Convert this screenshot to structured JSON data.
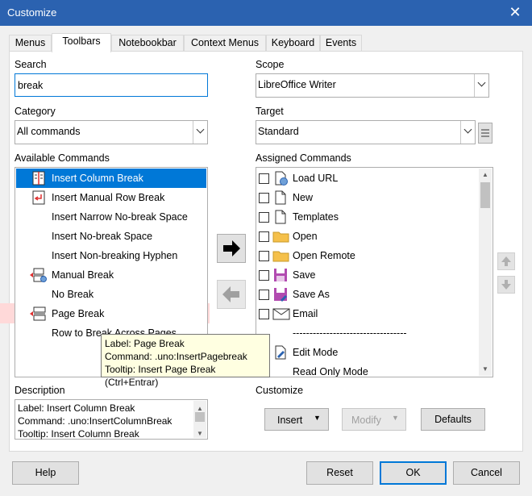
{
  "window": {
    "title": "Customize",
    "close_glyph": "✕"
  },
  "tabs": [
    "Menus",
    "Toolbars",
    "Notebookbar",
    "Context Menus",
    "Keyboard",
    "Events"
  ],
  "search": {
    "label": "Search",
    "value": "break"
  },
  "category": {
    "label": "Category",
    "value": "All commands"
  },
  "available": {
    "label": "Available Commands",
    "items": [
      {
        "label": "Insert Column Break",
        "icon": "column-break-icon",
        "selected": true
      },
      {
        "label": "Insert Manual Row Break",
        "icon": "row-break-icon"
      },
      {
        "label": "Insert Narrow No-break Space",
        "icon": ""
      },
      {
        "label": "Insert No-break Space",
        "icon": ""
      },
      {
        "label": "Insert Non-breaking Hyphen",
        "icon": ""
      },
      {
        "label": "Manual Break",
        "icon": "manual-break-icon"
      },
      {
        "label": "No Break",
        "icon": ""
      },
      {
        "label": "Page Break",
        "icon": "page-break-icon"
      },
      {
        "label": "Row to Break Across Pages",
        "icon": ""
      }
    ]
  },
  "tooltip": {
    "line1": "Label: Page Break",
    "line2": "Command: .uno:InsertPagebreak",
    "line3": "Tooltip: Insert Page Break (Ctrl+Entrar)"
  },
  "description": {
    "label": "Description",
    "line1": "Label: Insert Column Break",
    "line2": "Command: .uno:InsertColumnBreak",
    "line3": "Tooltip: Insert Column Break"
  },
  "scope": {
    "label": "Scope",
    "value": "LibreOffice Writer"
  },
  "target": {
    "label": "Target",
    "value": "Standard"
  },
  "assigned": {
    "label": "Assigned Commands",
    "items": [
      {
        "label": "Load URL",
        "icon": "load-url-icon"
      },
      {
        "label": "New",
        "icon": "document-icon"
      },
      {
        "label": "Templates",
        "icon": "document-icon"
      },
      {
        "label": "Open",
        "icon": "folder-icon"
      },
      {
        "label": "Open Remote",
        "icon": "folder-icon"
      },
      {
        "label": "Save",
        "icon": "save-icon"
      },
      {
        "label": "Save As",
        "icon": "save-as-icon"
      },
      {
        "label": "Email",
        "icon": "envelope-icon"
      },
      {
        "label": "----------------------------------",
        "icon": ""
      },
      {
        "label": "Edit Mode",
        "icon": "edit-mode-icon"
      },
      {
        "label": "Read Only Mode",
        "icon": ""
      }
    ]
  },
  "customize": {
    "label": "Customize",
    "insert": "Insert",
    "modify": "Modify",
    "defaults": "Defaults"
  },
  "footer": {
    "help": "Help",
    "reset": "Reset",
    "ok": "OK",
    "cancel": "Cancel"
  },
  "colors": {
    "titlebar": "#2b62b0",
    "selection": "#0078d7",
    "tooltip_bg": "#ffffe1",
    "highlight": "#ffd9d9"
  }
}
